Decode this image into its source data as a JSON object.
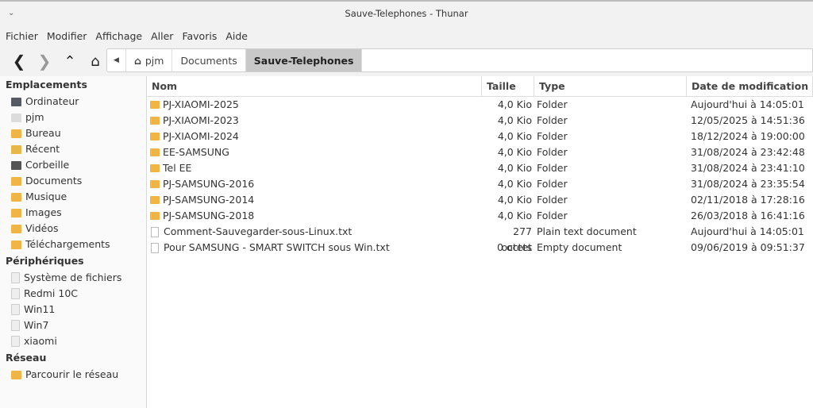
{
  "window": {
    "title": "Sauve-Telephones - Thunar"
  },
  "menu": [
    "Fichier",
    "Modifier",
    "Affichage",
    "Aller",
    "Favoris",
    "Aide"
  ],
  "path": [
    "pjm",
    "Documents",
    "Sauve-Telephones"
  ],
  "sidebar": {
    "places_title": "Emplacements",
    "places": [
      {
        "label": "Ordinateur",
        "color": "#555a63"
      },
      {
        "label": "pjm",
        "color": "#dcdcdc"
      },
      {
        "label": "Bureau",
        "color": "#f0b545"
      },
      {
        "label": "Récent",
        "color": "#e6b84a"
      },
      {
        "label": "Corbeille",
        "color": "#555"
      },
      {
        "label": "Documents",
        "color": "#f0b545"
      },
      {
        "label": "Musique",
        "color": "#f0b545"
      },
      {
        "label": "Images",
        "color": "#f0b545"
      },
      {
        "label": "Vidéos",
        "color": "#f0b545"
      },
      {
        "label": "Téléchargements",
        "color": "#f0b545"
      }
    ],
    "devices_title": "Périphériques",
    "devices": [
      {
        "label": "Système de fichiers"
      },
      {
        "label": "Redmi 10C"
      },
      {
        "label": "Win11"
      },
      {
        "label": "Win7"
      },
      {
        "label": "xiaomi"
      }
    ],
    "network_title": "Réseau",
    "network": [
      {
        "label": "Parcourir le réseau"
      }
    ]
  },
  "columns": [
    "Nom",
    "Taille",
    "Type",
    "Date de modification"
  ],
  "files": [
    {
      "name": "PJ-XIAOMI-2025",
      "size": "4,0 Kio",
      "type": "Folder",
      "date": "Aujourd'hui à 14:05:01",
      "icon": "folder"
    },
    {
      "name": "PJ-XIAOMI-2023",
      "size": "4,0 Kio",
      "type": "Folder",
      "date": "12/05/2025 à 14:51:36",
      "icon": "folder"
    },
    {
      "name": "PJ-XIAOMI-2024",
      "size": "4,0 Kio",
      "type": "Folder",
      "date": "18/12/2024 à 19:00:00",
      "icon": "folder"
    },
    {
      "name": "EE-SAMSUNG",
      "size": "4,0 Kio",
      "type": "Folder",
      "date": "31/08/2024 à 23:42:48",
      "icon": "folder"
    },
    {
      "name": "Tel EE",
      "size": "4,0 Kio",
      "type": "Folder",
      "date": "31/08/2024 à 23:41:10",
      "icon": "folder"
    },
    {
      "name": "PJ-SAMSUNG-2016",
      "size": "4,0 Kio",
      "type": "Folder",
      "date": "31/08/2024 à 23:35:54",
      "icon": "folder"
    },
    {
      "name": "PJ-SAMSUNG-2014",
      "size": "4,0 Kio",
      "type": "Folder",
      "date": "02/11/2018 à 17:28:16",
      "icon": "folder"
    },
    {
      "name": "PJ-SAMSUNG-2018",
      "size": "4,0 Kio",
      "type": "Folder",
      "date": "26/03/2018 à 16:41:16",
      "icon": "folder"
    },
    {
      "name": "Comment-Sauvegarder-sous-Linux.txt",
      "size": "277 octets",
      "type": "Plain text document",
      "date": "Aujourd'hui à 14:05:01",
      "icon": "text"
    },
    {
      "name": "Pour SAMSUNG - SMART SWITCH sous Win.txt",
      "size": "0 octet",
      "type": "Empty document",
      "date": "09/06/2019 à 09:51:37",
      "icon": "empty"
    }
  ]
}
